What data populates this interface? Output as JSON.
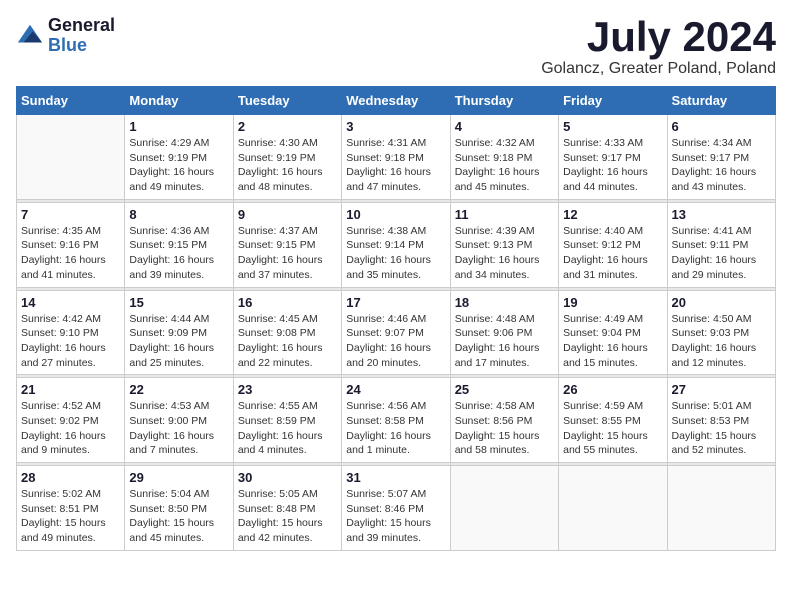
{
  "header": {
    "logo": {
      "general": "General",
      "blue": "Blue"
    },
    "title": "July 2024",
    "location": "Golancz, Greater Poland, Poland"
  },
  "days_of_week": [
    "Sunday",
    "Monday",
    "Tuesday",
    "Wednesday",
    "Thursday",
    "Friday",
    "Saturday"
  ],
  "weeks": [
    [
      {
        "num": "",
        "sunrise": "",
        "sunset": "",
        "daylight": ""
      },
      {
        "num": "1",
        "sunrise": "Sunrise: 4:29 AM",
        "sunset": "Sunset: 9:19 PM",
        "daylight": "Daylight: 16 hours and 49 minutes."
      },
      {
        "num": "2",
        "sunrise": "Sunrise: 4:30 AM",
        "sunset": "Sunset: 9:19 PM",
        "daylight": "Daylight: 16 hours and 48 minutes."
      },
      {
        "num": "3",
        "sunrise": "Sunrise: 4:31 AM",
        "sunset": "Sunset: 9:18 PM",
        "daylight": "Daylight: 16 hours and 47 minutes."
      },
      {
        "num": "4",
        "sunrise": "Sunrise: 4:32 AM",
        "sunset": "Sunset: 9:18 PM",
        "daylight": "Daylight: 16 hours and 45 minutes."
      },
      {
        "num": "5",
        "sunrise": "Sunrise: 4:33 AM",
        "sunset": "Sunset: 9:17 PM",
        "daylight": "Daylight: 16 hours and 44 minutes."
      },
      {
        "num": "6",
        "sunrise": "Sunrise: 4:34 AM",
        "sunset": "Sunset: 9:17 PM",
        "daylight": "Daylight: 16 hours and 43 minutes."
      }
    ],
    [
      {
        "num": "7",
        "sunrise": "Sunrise: 4:35 AM",
        "sunset": "Sunset: 9:16 PM",
        "daylight": "Daylight: 16 hours and 41 minutes."
      },
      {
        "num": "8",
        "sunrise": "Sunrise: 4:36 AM",
        "sunset": "Sunset: 9:15 PM",
        "daylight": "Daylight: 16 hours and 39 minutes."
      },
      {
        "num": "9",
        "sunrise": "Sunrise: 4:37 AM",
        "sunset": "Sunset: 9:15 PM",
        "daylight": "Daylight: 16 hours and 37 minutes."
      },
      {
        "num": "10",
        "sunrise": "Sunrise: 4:38 AM",
        "sunset": "Sunset: 9:14 PM",
        "daylight": "Daylight: 16 hours and 35 minutes."
      },
      {
        "num": "11",
        "sunrise": "Sunrise: 4:39 AM",
        "sunset": "Sunset: 9:13 PM",
        "daylight": "Daylight: 16 hours and 34 minutes."
      },
      {
        "num": "12",
        "sunrise": "Sunrise: 4:40 AM",
        "sunset": "Sunset: 9:12 PM",
        "daylight": "Daylight: 16 hours and 31 minutes."
      },
      {
        "num": "13",
        "sunrise": "Sunrise: 4:41 AM",
        "sunset": "Sunset: 9:11 PM",
        "daylight": "Daylight: 16 hours and 29 minutes."
      }
    ],
    [
      {
        "num": "14",
        "sunrise": "Sunrise: 4:42 AM",
        "sunset": "Sunset: 9:10 PM",
        "daylight": "Daylight: 16 hours and 27 minutes."
      },
      {
        "num": "15",
        "sunrise": "Sunrise: 4:44 AM",
        "sunset": "Sunset: 9:09 PM",
        "daylight": "Daylight: 16 hours and 25 minutes."
      },
      {
        "num": "16",
        "sunrise": "Sunrise: 4:45 AM",
        "sunset": "Sunset: 9:08 PM",
        "daylight": "Daylight: 16 hours and 22 minutes."
      },
      {
        "num": "17",
        "sunrise": "Sunrise: 4:46 AM",
        "sunset": "Sunset: 9:07 PM",
        "daylight": "Daylight: 16 hours and 20 minutes."
      },
      {
        "num": "18",
        "sunrise": "Sunrise: 4:48 AM",
        "sunset": "Sunset: 9:06 PM",
        "daylight": "Daylight: 16 hours and 17 minutes."
      },
      {
        "num": "19",
        "sunrise": "Sunrise: 4:49 AM",
        "sunset": "Sunset: 9:04 PM",
        "daylight": "Daylight: 16 hours and 15 minutes."
      },
      {
        "num": "20",
        "sunrise": "Sunrise: 4:50 AM",
        "sunset": "Sunset: 9:03 PM",
        "daylight": "Daylight: 16 hours and 12 minutes."
      }
    ],
    [
      {
        "num": "21",
        "sunrise": "Sunrise: 4:52 AM",
        "sunset": "Sunset: 9:02 PM",
        "daylight": "Daylight: 16 hours and 9 minutes."
      },
      {
        "num": "22",
        "sunrise": "Sunrise: 4:53 AM",
        "sunset": "Sunset: 9:00 PM",
        "daylight": "Daylight: 16 hours and 7 minutes."
      },
      {
        "num": "23",
        "sunrise": "Sunrise: 4:55 AM",
        "sunset": "Sunset: 8:59 PM",
        "daylight": "Daylight: 16 hours and 4 minutes."
      },
      {
        "num": "24",
        "sunrise": "Sunrise: 4:56 AM",
        "sunset": "Sunset: 8:58 PM",
        "daylight": "Daylight: 16 hours and 1 minute."
      },
      {
        "num": "25",
        "sunrise": "Sunrise: 4:58 AM",
        "sunset": "Sunset: 8:56 PM",
        "daylight": "Daylight: 15 hours and 58 minutes."
      },
      {
        "num": "26",
        "sunrise": "Sunrise: 4:59 AM",
        "sunset": "Sunset: 8:55 PM",
        "daylight": "Daylight: 15 hours and 55 minutes."
      },
      {
        "num": "27",
        "sunrise": "Sunrise: 5:01 AM",
        "sunset": "Sunset: 8:53 PM",
        "daylight": "Daylight: 15 hours and 52 minutes."
      }
    ],
    [
      {
        "num": "28",
        "sunrise": "Sunrise: 5:02 AM",
        "sunset": "Sunset: 8:51 PM",
        "daylight": "Daylight: 15 hours and 49 minutes."
      },
      {
        "num": "29",
        "sunrise": "Sunrise: 5:04 AM",
        "sunset": "Sunset: 8:50 PM",
        "daylight": "Daylight: 15 hours and 45 minutes."
      },
      {
        "num": "30",
        "sunrise": "Sunrise: 5:05 AM",
        "sunset": "Sunset: 8:48 PM",
        "daylight": "Daylight: 15 hours and 42 minutes."
      },
      {
        "num": "31",
        "sunrise": "Sunrise: 5:07 AM",
        "sunset": "Sunset: 8:46 PM",
        "daylight": "Daylight: 15 hours and 39 minutes."
      },
      {
        "num": "",
        "sunrise": "",
        "sunset": "",
        "daylight": ""
      },
      {
        "num": "",
        "sunrise": "",
        "sunset": "",
        "daylight": ""
      },
      {
        "num": "",
        "sunrise": "",
        "sunset": "",
        "daylight": ""
      }
    ]
  ]
}
